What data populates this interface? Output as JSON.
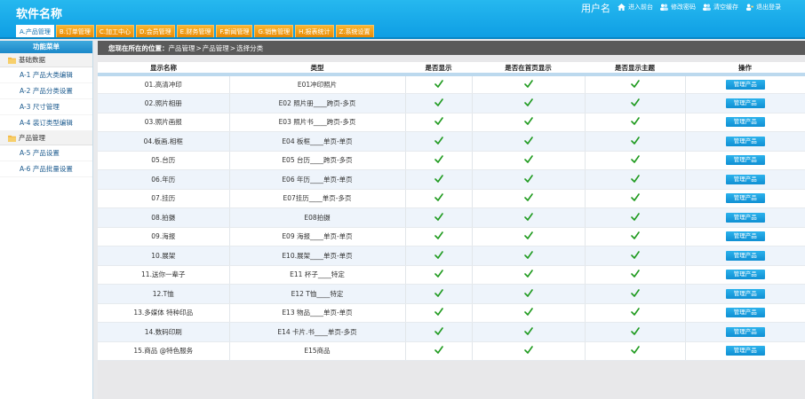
{
  "header": {
    "app_title": "软件名称",
    "username": "用户名",
    "links": [
      {
        "label": "进入前台",
        "icon": "home-icon"
      },
      {
        "label": "修改密码",
        "icon": "users-icon"
      },
      {
        "label": "清空缓存",
        "icon": "users-icon"
      },
      {
        "label": "退出登录",
        "icon": "user-exit-icon"
      }
    ]
  },
  "tabs": [
    {
      "label": "A.产品管理",
      "active": true
    },
    {
      "label": "B.订单管理"
    },
    {
      "label": "C.加工中心"
    },
    {
      "label": "D.会员管理"
    },
    {
      "label": "E.财务管理"
    },
    {
      "label": "F.新闻管理"
    },
    {
      "label": "G.销售管理"
    },
    {
      "label": "H.报表统计"
    },
    {
      "label": "Z.系统设置"
    }
  ],
  "sidebar": {
    "title": "功能菜单",
    "groups": [
      {
        "label": "基础数据",
        "items": [
          "A-1 产品大类编辑",
          "A-2 产品分类设置",
          "A-3 尺寸管理",
          "A-4 装订类型编辑"
        ]
      },
      {
        "label": "产品管理",
        "items": [
          "A-5 产品设置",
          "A-6 产品批量设置"
        ]
      }
    ]
  },
  "breadcrumb": {
    "prefix": "您现在所在的位置：",
    "items": [
      "产品管理",
      "产品管理",
      "选择分类"
    ],
    "separator": " > "
  },
  "table": {
    "headers": [
      "显示名称",
      "类型",
      "是否显示",
      "是否在首页显示",
      "是否显示主题",
      "操作"
    ],
    "action_label": "管理产品",
    "check_color": "#1e9a1e",
    "rows": [
      {
        "name": "01.高清冲印",
        "type": "E01冲印照片"
      },
      {
        "name": "02.照片相册",
        "type": "E02 照片册____跨页-多页"
      },
      {
        "name": "03.照片画报",
        "type": "E03 照片书____跨页-多页"
      },
      {
        "name": "04.板画.相框",
        "type": "E04 板框____单页-单页"
      },
      {
        "name": "05.台历",
        "type": "E05 台历____跨页-多页"
      },
      {
        "name": "06.年历",
        "type": "E06 年历____单页-单页"
      },
      {
        "name": "07.挂历",
        "type": "E07挂历____单页-多页"
      },
      {
        "name": "08.拍摄",
        "type": "E08拍摄"
      },
      {
        "name": "09.海报",
        "type": "E09 海报____单页-单页"
      },
      {
        "name": "10.展架",
        "type": "E10.展架____单页-单页"
      },
      {
        "name": "11.送你一辈子",
        "type": "E11 杯子____特定"
      },
      {
        "name": "12.T恤",
        "type": "E12 T恤____特定"
      },
      {
        "name": "13.多媒体 特种印品",
        "type": "E13 物品____单页-单页"
      },
      {
        "name": "14.数码印刷",
        "type": "E14 卡片.书____单页-多页"
      },
      {
        "name": "15.商品 @特色服务",
        "type": "E15商品"
      }
    ]
  }
}
